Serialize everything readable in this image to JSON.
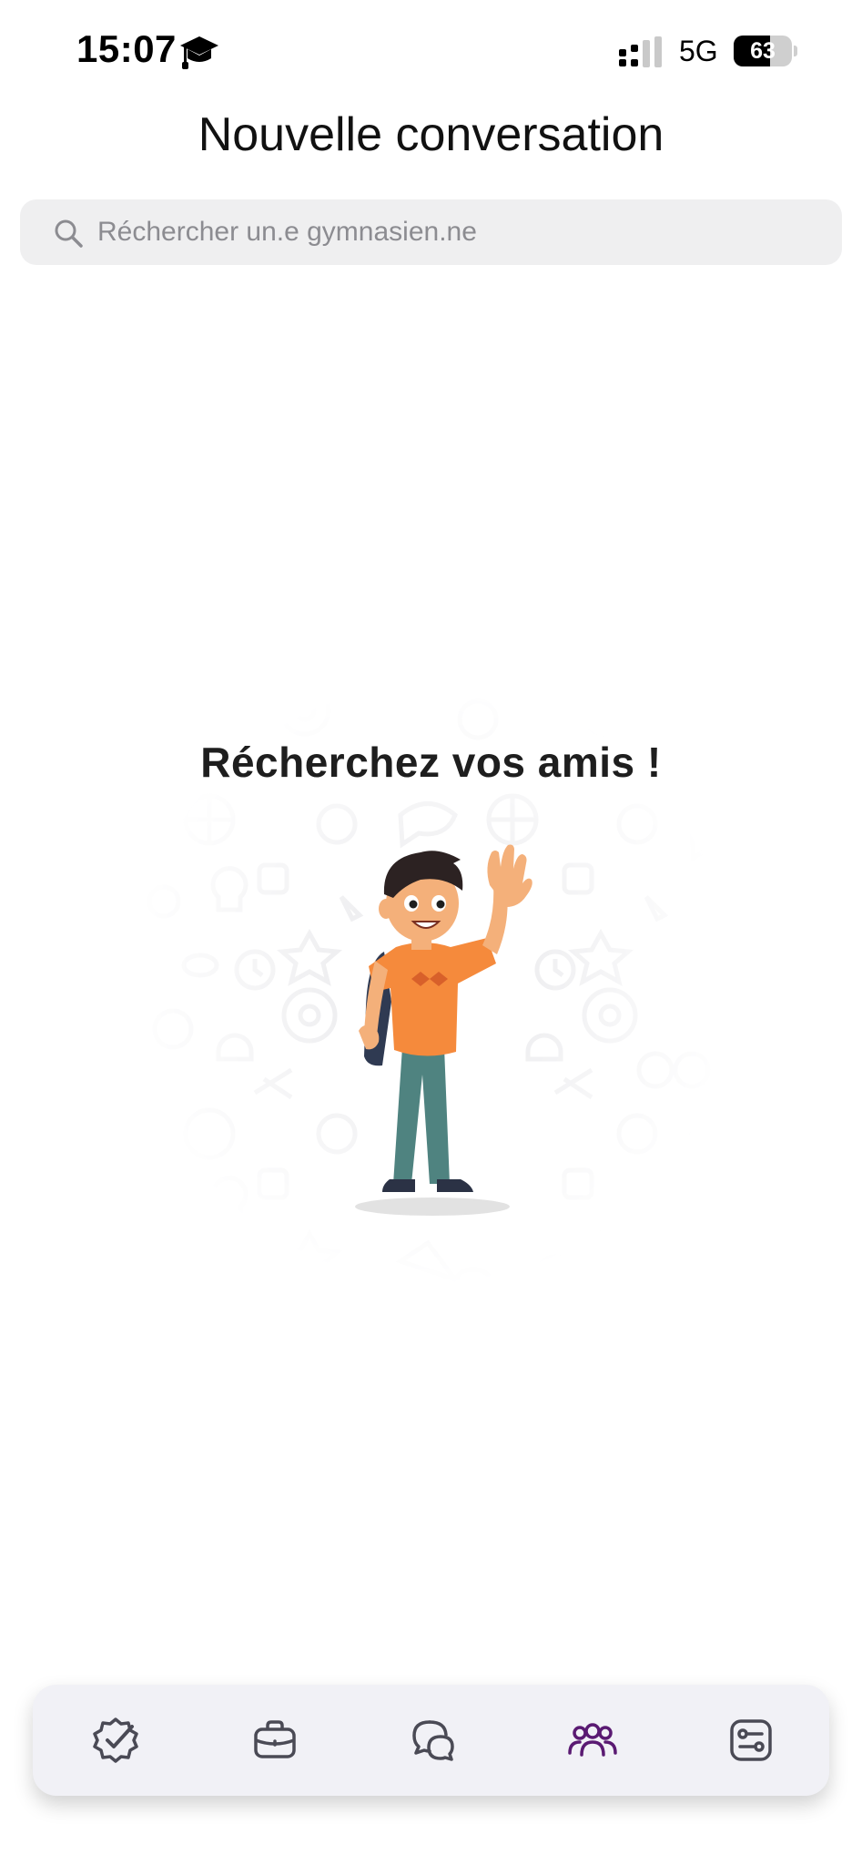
{
  "status_bar": {
    "time": "15:07",
    "status_icon": "graduation-cap-icon",
    "network": "5G",
    "battery_level": "63",
    "signal_bars_active": 2
  },
  "header": {
    "title": "Nouvelle conversation"
  },
  "search": {
    "placeholder": "Réchercher un.e gymnasien.ne",
    "value": ""
  },
  "empty_state": {
    "title": "Récherchez vos amis !",
    "illustration": "waving-student-illustration"
  },
  "tab_bar": {
    "items": [
      {
        "icon": "badge-check-icon",
        "active": false
      },
      {
        "icon": "briefcase-icon",
        "active": false
      },
      {
        "icon": "chat-bubbles-icon",
        "active": false
      },
      {
        "icon": "people-icon",
        "active": true
      },
      {
        "icon": "settings-sliders-icon",
        "active": false
      }
    ]
  },
  "colors": {
    "accent": "#5a1a72",
    "tab_icon": "#4a4a55",
    "search_bg": "#efeff0",
    "tab_bar_bg": "#f1f1f6"
  }
}
